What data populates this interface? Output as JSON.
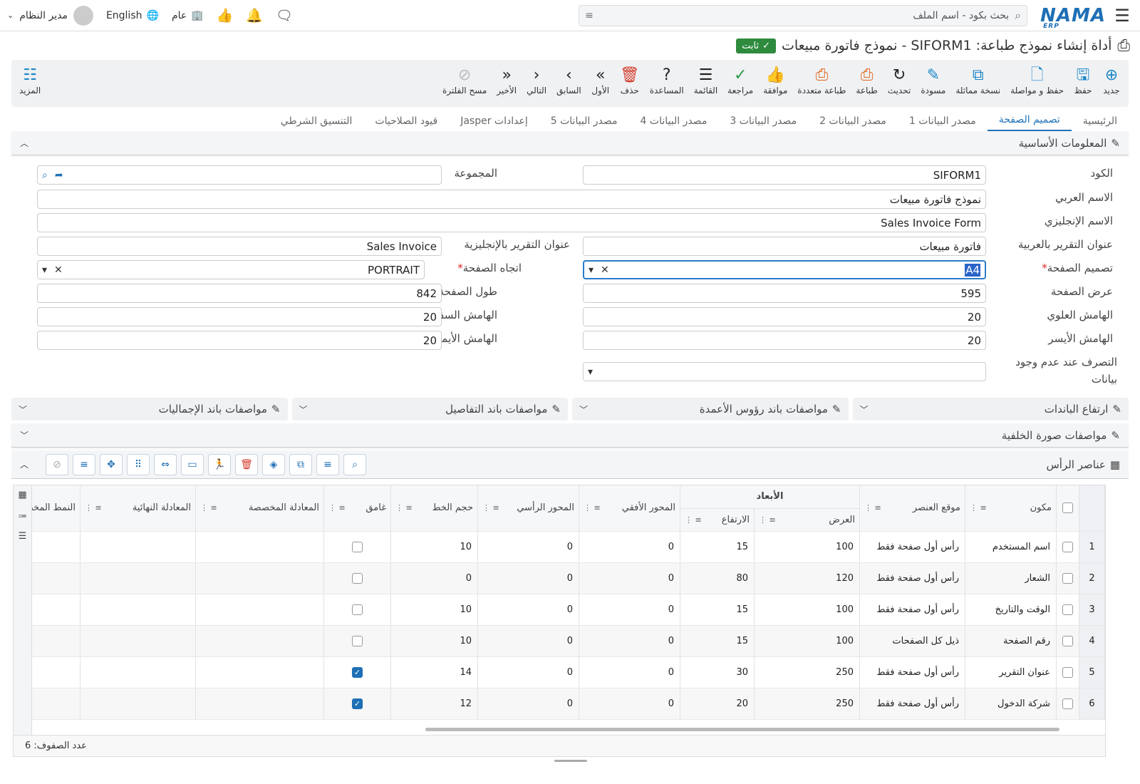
{
  "topbar": {
    "search_placeholder": "بحث بكود - اسم الملف",
    "logo": "NAMA",
    "logo_sub": "ERP",
    "language": "English",
    "company": "عام",
    "user": "مدير النظام"
  },
  "header": {
    "title": "أداة إنشاء نموذج طباعة: SIFORM1 - نموذج فاتورة مبيعات",
    "status": "ثابت"
  },
  "toolbar": {
    "items": [
      {
        "label": "جديد",
        "icon": "plus-circle-icon",
        "color": "blue",
        "glyph": "⊕"
      },
      {
        "label": "حفظ",
        "icon": "save-icon",
        "color": "blue",
        "glyph": "🖫"
      },
      {
        "label": "حفظ و مواصلة",
        "icon": "save-continue-icon",
        "color": "blue",
        "glyph": "🗋"
      },
      {
        "label": "نسخة مماثلة",
        "icon": "duplicate-icon",
        "color": "blue",
        "glyph": "⧉"
      },
      {
        "label": "مسودة",
        "icon": "draft-icon",
        "color": "blue",
        "glyph": "✎"
      },
      {
        "label": "تحديث",
        "icon": "refresh-icon",
        "color": "dark",
        "glyph": "↻"
      },
      {
        "label": "طباعة",
        "icon": "print-icon",
        "color": "orange",
        "glyph": "⎙"
      },
      {
        "label": "طباعة متعددة",
        "icon": "multi-print-icon",
        "color": "orange",
        "glyph": "⎙"
      },
      {
        "label": "موافقة",
        "icon": "approve-icon",
        "color": "gray",
        "glyph": "👍"
      },
      {
        "label": "مراجعة",
        "icon": "review-icon",
        "color": "green",
        "glyph": "✓"
      },
      {
        "label": "القائمة",
        "icon": "list-icon",
        "color": "dark",
        "glyph": "☰"
      },
      {
        "label": "المساعدة",
        "icon": "help-icon",
        "color": "dark",
        "glyph": "?"
      },
      {
        "label": "حذف",
        "icon": "delete-icon",
        "color": "red",
        "glyph": "🗑"
      },
      {
        "label": "الأول",
        "icon": "first-icon",
        "color": "dark",
        "glyph": "»"
      },
      {
        "label": "السابق",
        "icon": "previous-icon",
        "color": "dark",
        "glyph": "›"
      },
      {
        "label": "التالي",
        "icon": "next-icon",
        "color": "dark",
        "glyph": "‹"
      },
      {
        "label": "الأخير",
        "icon": "last-icon",
        "color": "dark",
        "glyph": "«"
      },
      {
        "label": "مسح الفلترة",
        "icon": "clear-filter-icon",
        "color": "gray",
        "glyph": "⊘"
      }
    ],
    "more": "المزيد"
  },
  "tabs": [
    "الرئيسية",
    "تصميم الصفحة",
    "مصدر البيانات 1",
    "مصدر البيانات 2",
    "مصدر البيانات 3",
    "مصدر البيانات 4",
    "مصدر البيانات 5",
    "إعدادات Jasper",
    "قيود الصلاحيات",
    "التنسيق الشرطي"
  ],
  "basic_section": "المعلومات الأساسية",
  "form": {
    "code_label": "الكود",
    "code": "SIFORM1",
    "group_label": "المجموعة",
    "group": "",
    "arabic_name_label": "الاسم العربي",
    "arabic_name": "نموذج فاتورة مبيعات",
    "english_name_label": "الاسم الإنجليزي",
    "english_name": "Sales Invoice Form",
    "ar_title_label": "عنوان التقرير بالعربية",
    "ar_title": "فاتورة مبيعات",
    "en_title_label": "عنوان التقرير بالإنجليزية",
    "en_title": "Sales Invoice",
    "page_design_label": "تصميم الصفحة",
    "page_design": "A4",
    "orientation_label": "اتجاه الصفحة",
    "orientation": "PORTRAIT",
    "page_width_label": "عرض الصفحة",
    "page_width": "595",
    "page_height_label": "طول الصفحة",
    "page_height": "842",
    "top_margin_label": "الهامش العلوي",
    "top_margin": "20",
    "bottom_margin_label": "الهامش السفلي",
    "bottom_margin": "20",
    "left_margin_label": "الهامش الأيسر",
    "left_margin": "20",
    "right_margin_label": "الهامش الأيمن",
    "right_margin": "20",
    "no_data_label": "التصرف عند عدم وجود بيانات",
    "no_data": ""
  },
  "bands": [
    "ارتفاع الباندات",
    "مواصفات باند رؤوس الأعمدة",
    "مواصفات باند التفاصيل",
    "مواصفات باند الإجماليات"
  ],
  "background_section": "مواصفات صورة الخلفية",
  "header_elements": "عناصر الرأس",
  "grid": {
    "columns": {
      "component": "مكون",
      "position": "موقع العنصر",
      "dimensions": "الأبعاد",
      "width": "العرض",
      "height": "الارتفاع",
      "x": "المحور الأفقي",
      "y": "المحور الرأسي",
      "font_size": "حجم الخط",
      "bold": "غامق",
      "custom_eq": "المعادلة المخصصة",
      "final_eq": "المعادلة النهائية",
      "pattern": "النمط المخص"
    },
    "rows": [
      {
        "n": "1",
        "component": "اسم المستخدم",
        "position": "رأس أول صفحة فقط",
        "width": "100",
        "height": "15",
        "x": "0",
        "y": "0",
        "font": "10",
        "bold": false
      },
      {
        "n": "2",
        "component": "الشعار",
        "position": "رأس أول صفحة فقط",
        "width": "120",
        "height": "80",
        "x": "0",
        "y": "0",
        "font": "0",
        "bold": false
      },
      {
        "n": "3",
        "component": "الوقت والتاريخ",
        "position": "رأس أول صفحة فقط",
        "width": "100",
        "height": "15",
        "x": "0",
        "y": "0",
        "font": "10",
        "bold": false
      },
      {
        "n": "4",
        "component": "رقم الصفحة",
        "position": "ذيل كل الصفحات",
        "width": "100",
        "height": "15",
        "x": "0",
        "y": "0",
        "font": "10",
        "bold": false
      },
      {
        "n": "5",
        "component": "عنوان التقرير",
        "position": "رأس أول صفحة فقط",
        "width": "250",
        "height": "30",
        "x": "0",
        "y": "0",
        "font": "14",
        "bold": true
      },
      {
        "n": "6",
        "component": "شركة الدخول",
        "position": "رأس أول صفحة فقط",
        "width": "250",
        "height": "20",
        "x": "0",
        "y": "0",
        "font": "12",
        "bold": true
      }
    ],
    "row_count": "عدد الصفوف: 6"
  }
}
